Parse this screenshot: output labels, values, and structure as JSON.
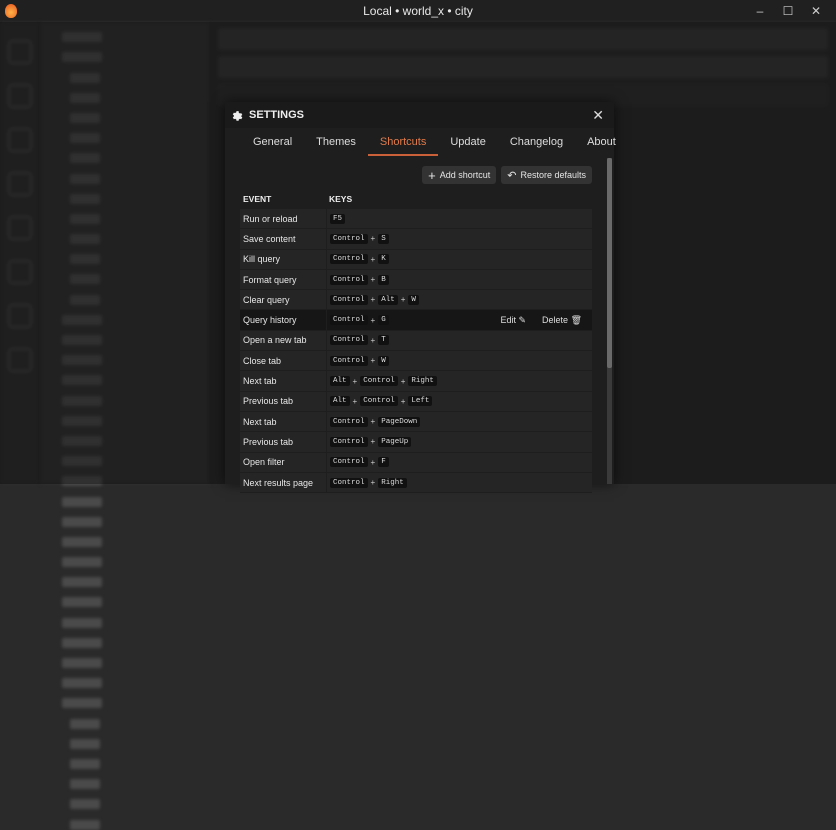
{
  "window": {
    "title": "Local • world_x • city",
    "minimize": "–",
    "maximize": "☐",
    "close": "✕"
  },
  "settings": {
    "title": "SETTINGS",
    "close": "✕",
    "tabs": [
      {
        "label": "General"
      },
      {
        "label": "Themes"
      },
      {
        "label": "Shortcuts",
        "active": true
      },
      {
        "label": "Update"
      },
      {
        "label": "Changelog"
      },
      {
        "label": "About"
      }
    ],
    "add_shortcut": "Add shortcut",
    "restore_defaults": "Restore defaults",
    "columns": {
      "event": "EVENT",
      "keys": "KEYS"
    },
    "edit_label": "Edit",
    "delete_label": "Delete",
    "rows": [
      {
        "event": "Run or reload",
        "keys": [
          "F5"
        ]
      },
      {
        "event": "Save content",
        "keys": [
          "Control",
          "S"
        ]
      },
      {
        "event": "Kill query",
        "keys": [
          "Control",
          "K"
        ]
      },
      {
        "event": "Format query",
        "keys": [
          "Control",
          "B"
        ]
      },
      {
        "event": "Clear query",
        "keys": [
          "Control",
          "Alt",
          "W"
        ]
      },
      {
        "event": "Query history",
        "keys": [
          "Control",
          "G"
        ],
        "hovered": true
      },
      {
        "event": "Open a new tab",
        "keys": [
          "Control",
          "T"
        ]
      },
      {
        "event": "Close tab",
        "keys": [
          "Control",
          "W"
        ]
      },
      {
        "event": "Next tab",
        "keys": [
          "Alt",
          "Control",
          "Right"
        ]
      },
      {
        "event": "Previous tab",
        "keys": [
          "Alt",
          "Control",
          "Left"
        ]
      },
      {
        "event": "Next tab",
        "keys": [
          "Control",
          "PageDown"
        ]
      },
      {
        "event": "Previous tab",
        "keys": [
          "Control",
          "PageUp"
        ]
      },
      {
        "event": "Open filter",
        "keys": [
          "Control",
          "F"
        ]
      },
      {
        "event": "Next results page",
        "keys": [
          "Control",
          "Right"
        ]
      }
    ]
  }
}
